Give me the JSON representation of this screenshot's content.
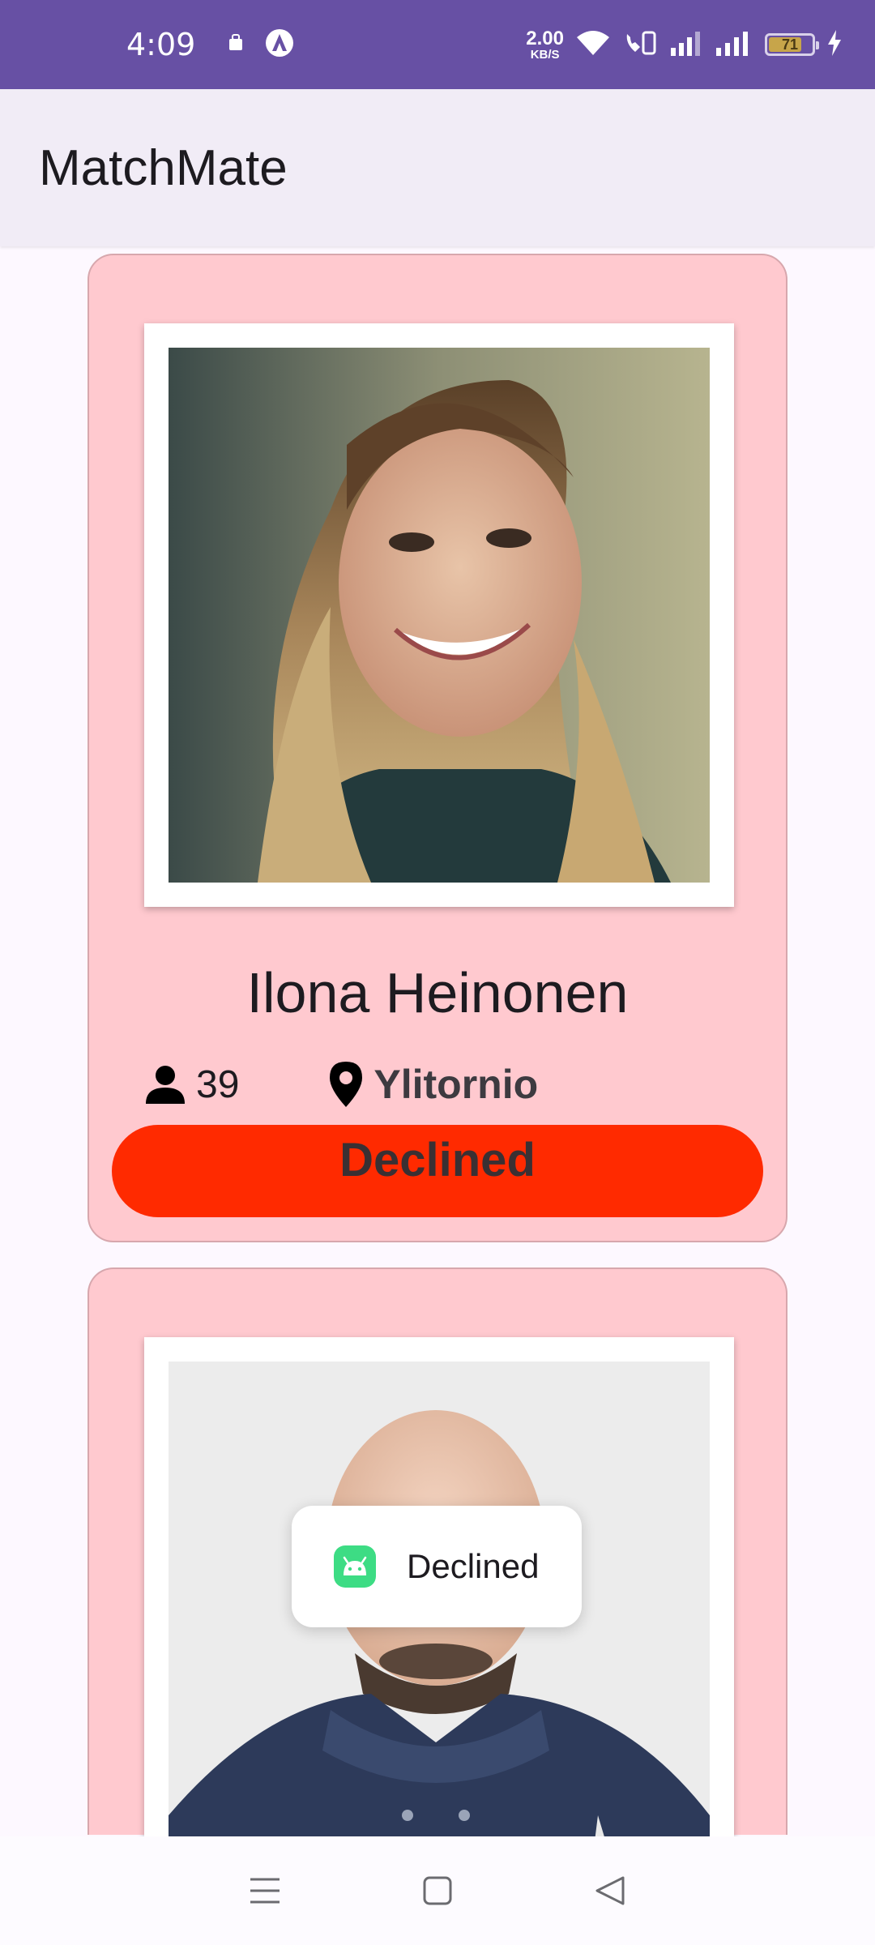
{
  "status_bar": {
    "time": "4:09",
    "net_speed_value": "2.00",
    "net_speed_unit": "KB/S",
    "battery_level": "71",
    "battery_fraction": 0.71
  },
  "app_bar": {
    "title": "MatchMate"
  },
  "cards": [
    {
      "name": "Ilona Heinonen",
      "age": "39",
      "location": "Ylitornio",
      "status_label": "Declined",
      "status_color": "#ff2a00",
      "card_color": "#ffc9cf"
    }
  ],
  "toast": {
    "message": "Declined"
  },
  "nav": {
    "menu_icon": "menu-icon",
    "home_icon": "home-icon",
    "back_icon": "back-icon"
  },
  "colors": {
    "primary": "#6750a4",
    "app_bar_bg": "#f1ecf6",
    "card_bg": "#ffc9cf",
    "declined": "#ff2a00"
  }
}
